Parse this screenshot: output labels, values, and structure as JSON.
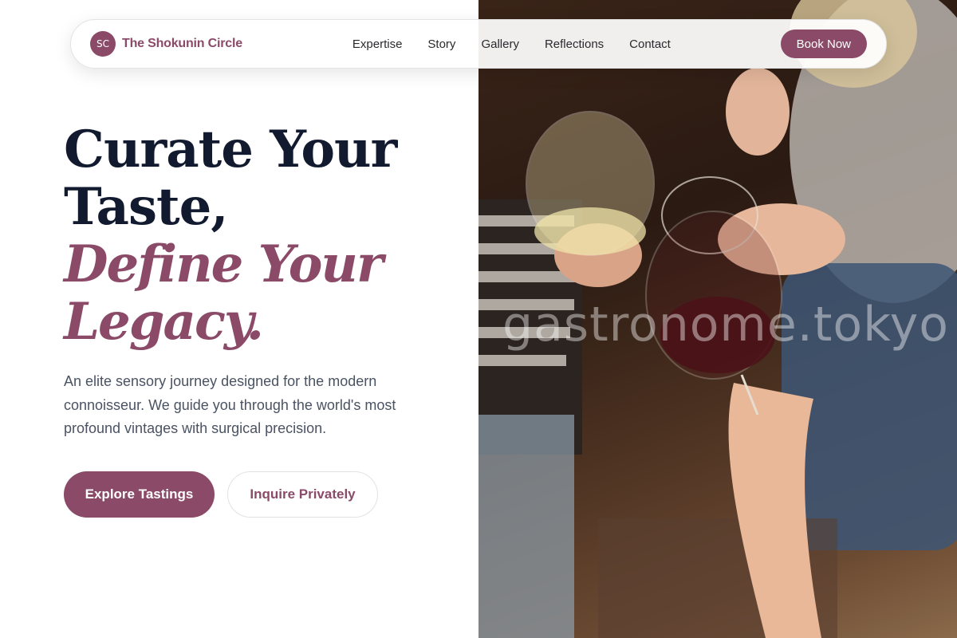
{
  "brand": {
    "logo_initials": "SC",
    "name": "The Shokunin Circle"
  },
  "nav": {
    "links": [
      "Expertise",
      "Story",
      "Gallery",
      "Reflections",
      "Contact"
    ],
    "cta": "Book Now"
  },
  "hero": {
    "title_lines": [
      "Curate Your",
      "Taste,"
    ],
    "accent_lines": [
      "Define Your",
      "Legacy."
    ],
    "subtitle": "An elite sensory journey designed for the modern connoisseur. We guide you through the world's most profound vintages with surgical precision.",
    "primary_cta": "Explore Tastings",
    "secondary_cta": "Inquire Privately"
  },
  "photo": {
    "watermark": "gastronome.tokyo",
    "subject": "wine-glasses-toast-photo"
  },
  "colors": {
    "accent": "#8a4a68",
    "heading": "#111a2e",
    "body_text": "#4a5363"
  }
}
